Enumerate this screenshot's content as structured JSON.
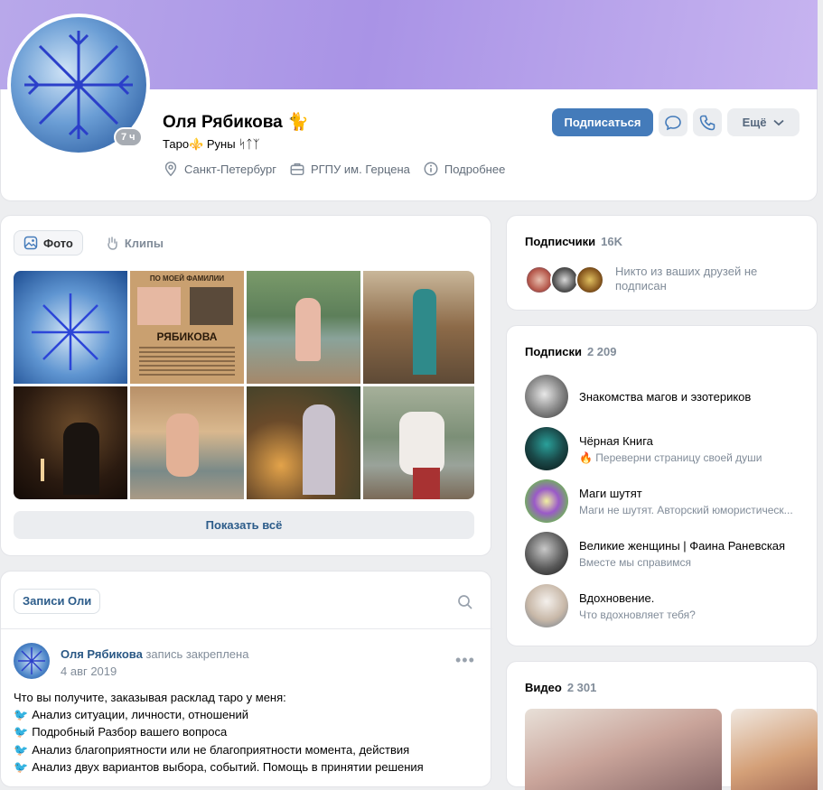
{
  "profile": {
    "name": "Оля Рябикова",
    "name_emoji": "🐈",
    "online": "7 ч",
    "status": "Таро⚜️ Руны ᛋᛏᛉ",
    "city": "Санкт-Петербург",
    "university": "РГПУ им. Герцена",
    "more_info": "Подробнее"
  },
  "actions": {
    "subscribe": "Подписаться",
    "more": "Ещё"
  },
  "photos": {
    "tab_photo": "Фото",
    "tab_clips": "Клипы",
    "show_all": "Показать всё",
    "photo2_title": "ПО МОЕЙ ФАМИЛИИ",
    "photo2_name": "РЯБИКОВА"
  },
  "wall": {
    "tab": "Записи Оли",
    "post": {
      "author": "Оля Рябикова",
      "pinned": "запись закреплена",
      "date": "4 авг 2019",
      "lines": [
        "Что вы получите, заказывая расклад таро у меня:",
        "Анализ ситуации, личности, отношений",
        "Подробный Разбор вашего вопроса",
        "Анализ благоприятности или не благоприятности момента, действия",
        "Анализ двух вариантов выбора, событий. Помощь в принятии решения"
      ]
    }
  },
  "subscribers": {
    "title": "Подписчики",
    "count": "16K",
    "text": "Никто из ваших друзей не подписан"
  },
  "following": {
    "title": "Подписки",
    "count": "2 209",
    "items": [
      {
        "name": "Знакомства магов и эзотериков",
        "desc": ""
      },
      {
        "name": "Чёрная Книга",
        "desc": "🔥 Переверни страницу своей души"
      },
      {
        "name": "Маги шутят",
        "desc": "Маги не шутят. Авторский юмористическ..."
      },
      {
        "name": "Великие женщины | Фаина Раневская",
        "desc": "Вместе мы справимся"
      },
      {
        "name": "Вдохновение.",
        "desc": "Что вдохновляет тебя?"
      }
    ]
  },
  "videos": {
    "title": "Видео",
    "count": "2 301"
  },
  "colors": {
    "accent": "#447bba",
    "link": "#2a5885",
    "muted": "#818c99"
  }
}
